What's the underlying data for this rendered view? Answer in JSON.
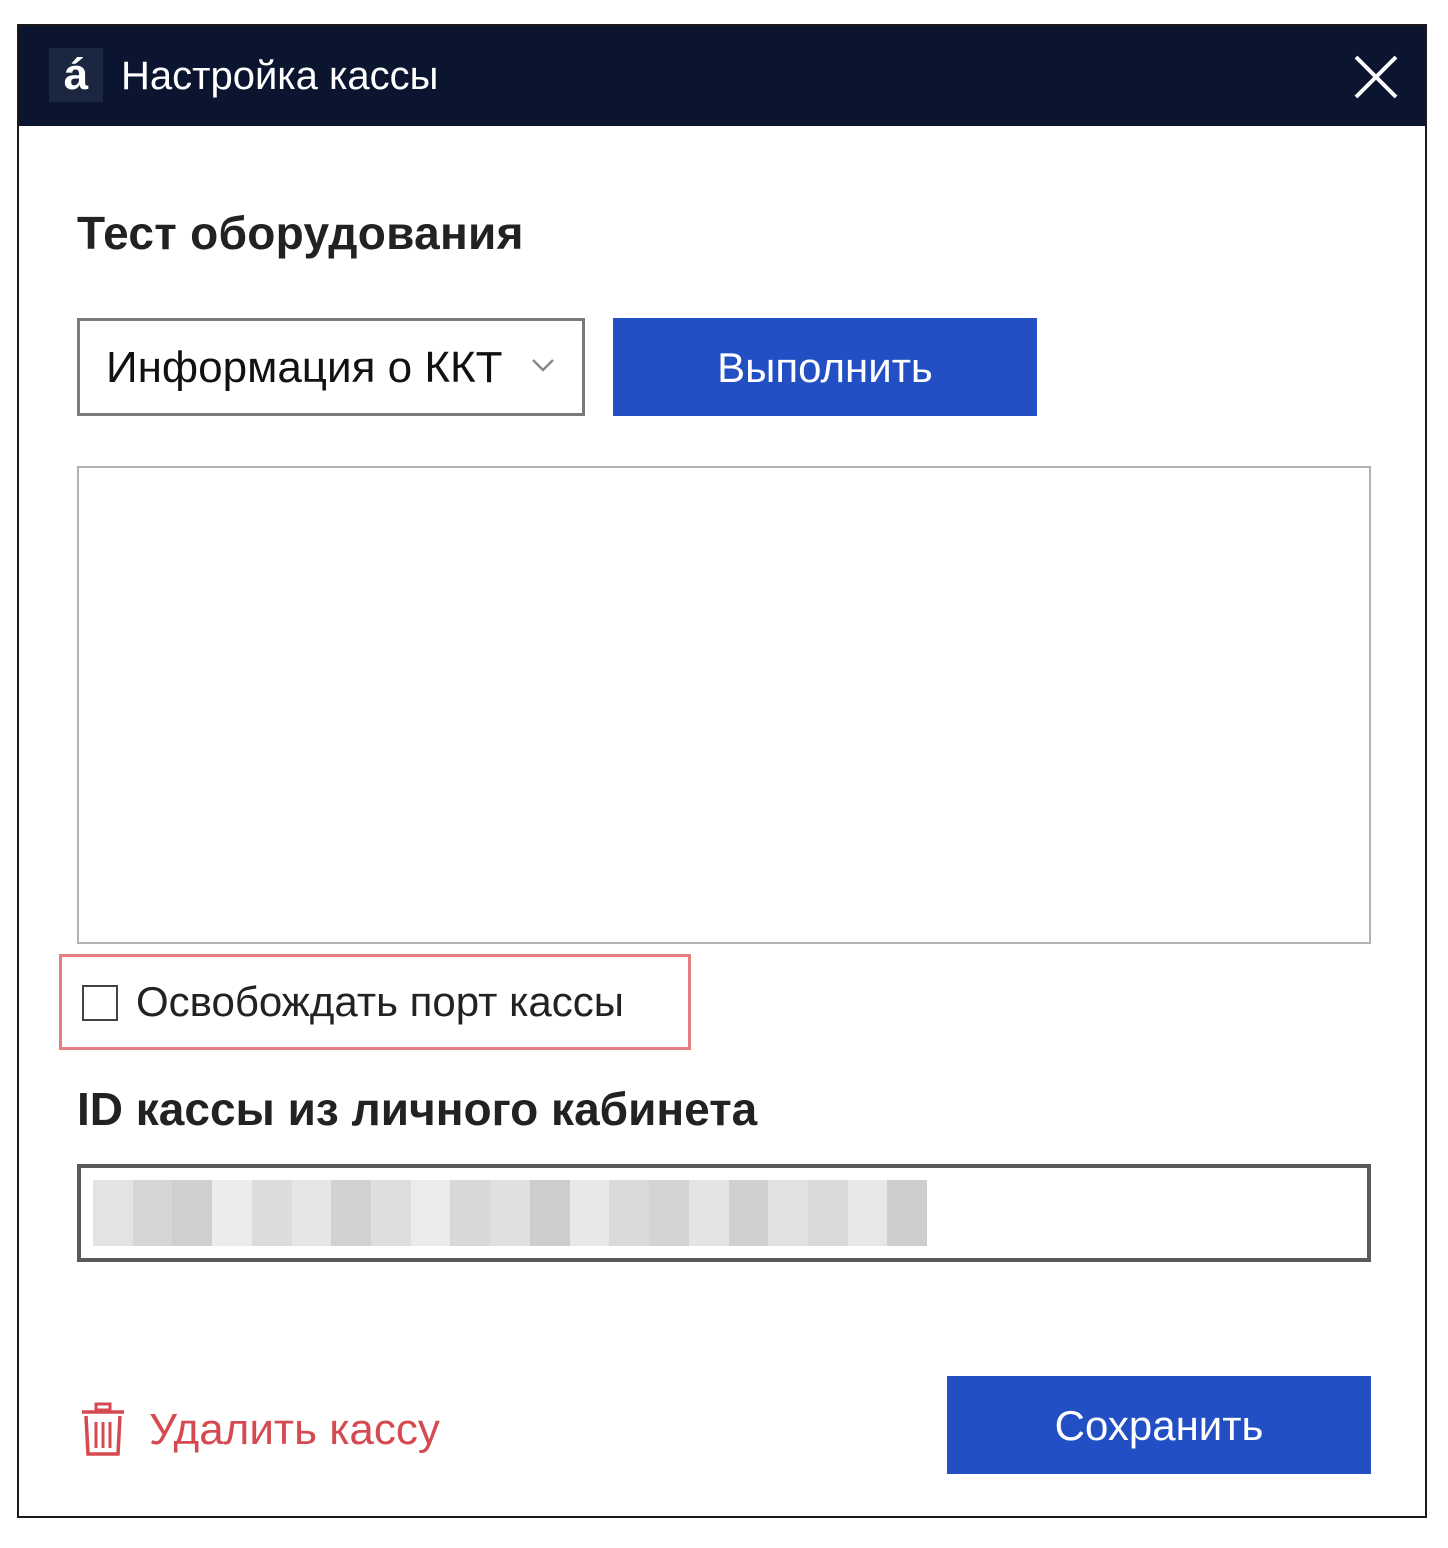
{
  "window": {
    "logo_text": "á",
    "title": "Настройка кассы"
  },
  "test": {
    "section_title": "Тест оборудования",
    "selected_command": "Информация о ККТ",
    "run_label": "Выполнить",
    "output": ""
  },
  "port": {
    "checked": false,
    "label": "Освобождать порт кассы"
  },
  "cash_id": {
    "title": "ID кассы из личного кабинета",
    "value_obscured": true
  },
  "footer": {
    "delete_label": "Удалить кассу",
    "save_label": "Сохранить"
  },
  "colors": {
    "titlebar": "#0b1530",
    "primary": "#2250c4",
    "danger": "#d54a50",
    "highlight": "#e57f7f"
  },
  "icons": {
    "close": "close-icon",
    "chevron": "chevron-down-icon",
    "trash": "trash-icon"
  }
}
